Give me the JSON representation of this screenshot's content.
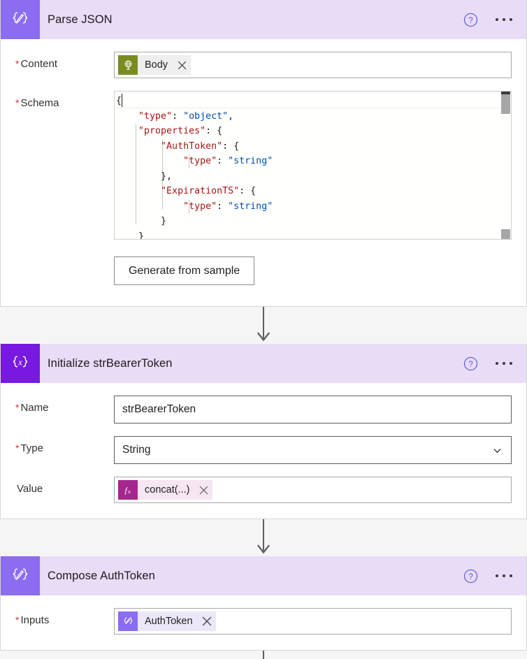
{
  "cards": [
    {
      "id": "parse-json",
      "title": "Parse JSON",
      "icon": "parse-json-icon",
      "help_label": "?",
      "fields": {
        "content_label": "Content",
        "content_required": "*",
        "content_token": "Body",
        "content_token_icon": "http-globe-icon",
        "schema_label": "Schema",
        "schema_required": "*",
        "schema_code_lines": [
          "{",
          "    \"type\": \"object\",",
          "    \"properties\": {",
          "        \"AuthToken\": {",
          "            \"type\": \"string\"",
          "        },",
          "        \"ExpirationTS\": {",
          "            \"type\": \"string\"",
          "        }",
          "    }"
        ],
        "generate_button": "Generate from sample"
      }
    },
    {
      "id": "initialize-variable",
      "title": "Initialize strBearerToken",
      "icon": "initialize-variable-icon",
      "help_label": "?",
      "fields": {
        "name_label": "Name",
        "name_required": "*",
        "name_value": "strBearerToken",
        "type_label": "Type",
        "type_required": "*",
        "type_value": "String",
        "value_label": "Value",
        "value_required": "",
        "value_token": "concat(...)",
        "value_token_icon": "expression-fx-icon"
      }
    },
    {
      "id": "compose",
      "title": "Compose AuthToken",
      "icon": "compose-icon",
      "help_label": "?",
      "fields": {
        "inputs_label": "Inputs",
        "inputs_required": "*",
        "inputs_token": "AuthToken",
        "inputs_token_icon": "parse-json-icon"
      }
    }
  ],
  "colors": {
    "header_bg": "#e8dcf7",
    "parse_json_icon_bg": "#8c6cf0",
    "initialize_icon_bg": "#7719e0",
    "compose_icon_bg": "#8c6cf0",
    "http_token_icon_bg": "#7a8c21",
    "expression_icon_bg": "#a4268f",
    "required_asterisk": "#d13438",
    "json_key": "#a31515",
    "json_value": "#0451a5",
    "canvas_bg": "#f5f5f5",
    "connector_arrow": "#605e5c"
  }
}
